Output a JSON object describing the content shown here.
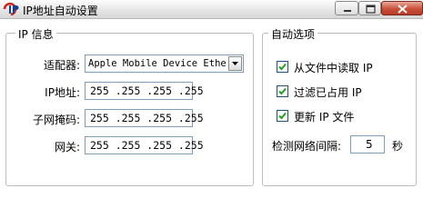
{
  "window": {
    "title": "IP地址自动设置"
  },
  "ip_group": {
    "legend": "IP 信息",
    "adapter": {
      "label": "适配器:",
      "value": "Apple Mobile Device Ethern"
    },
    "ip": {
      "label": "IP地址:",
      "value": "255 .255 .255 .255"
    },
    "mask": {
      "label": "子网掩码:",
      "value": "255 .255 .255 .255"
    },
    "gateway": {
      "label": "网关:",
      "value": "255 .255 .255 .255"
    }
  },
  "auto_group": {
    "legend": "自动选项",
    "options": [
      {
        "label": "从文件中读取 IP",
        "checked": true
      },
      {
        "label": "过滤已占用 IP",
        "checked": true
      },
      {
        "label": "更新 IP 文件",
        "checked": true
      }
    ],
    "interval": {
      "label": "检测网络间隔:",
      "value": "5",
      "unit": "秒"
    }
  }
}
